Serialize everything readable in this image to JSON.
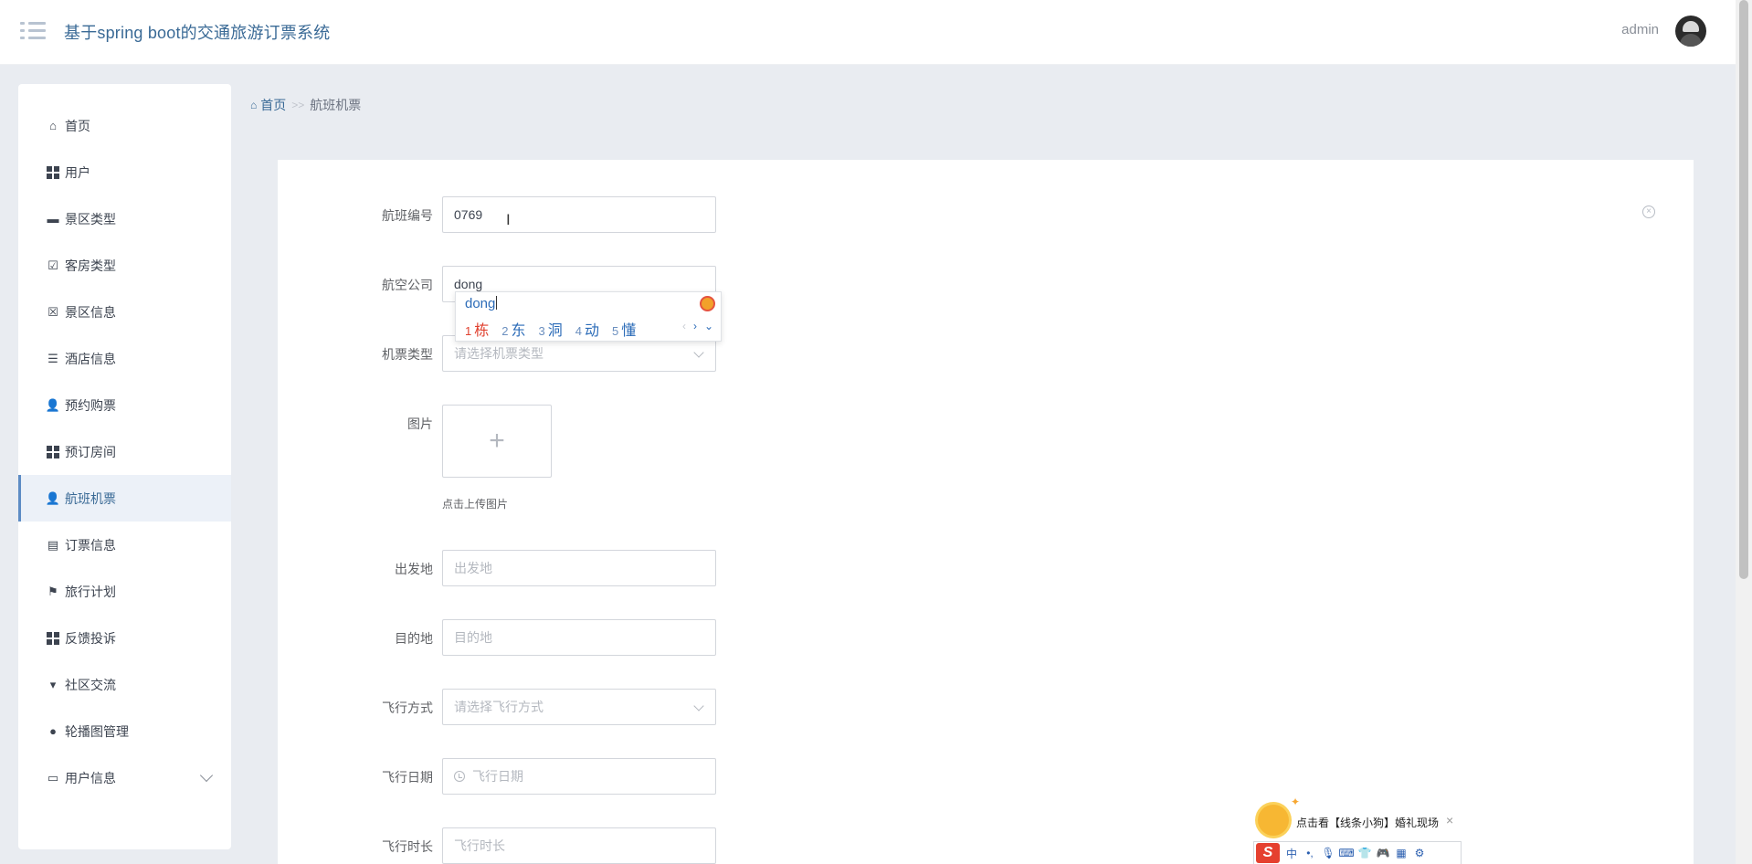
{
  "header": {
    "title": "基于spring boot的交通旅游订票系统",
    "user": "admin"
  },
  "sidebar": {
    "items": [
      {
        "label": "首页",
        "icon": "home-icon"
      },
      {
        "label": "用户",
        "icon": "grid-icon"
      },
      {
        "label": "景区类型",
        "icon": "comment-icon"
      },
      {
        "label": "客房类型",
        "icon": "clipboard-check-icon"
      },
      {
        "label": "景区信息",
        "icon": "clipboard-x-icon"
      },
      {
        "label": "酒店信息",
        "icon": "sliders-icon"
      },
      {
        "label": "预约购票",
        "icon": "person-icon"
      },
      {
        "label": "预订房间",
        "icon": "grid-icon"
      },
      {
        "label": "航班机票",
        "icon": "person-icon",
        "active": true
      },
      {
        "label": "订票信息",
        "icon": "clipboard-icon"
      },
      {
        "label": "旅行计划",
        "icon": "flag-icon"
      },
      {
        "label": "反馈投诉",
        "icon": "grid-icon"
      },
      {
        "label": "社区交流",
        "icon": "paint-roller-icon"
      },
      {
        "label": "轮播图管理",
        "icon": "leaf-icon"
      },
      {
        "label": "用户信息",
        "icon": "id-card-icon",
        "expandable": true
      }
    ]
  },
  "breadcrumb": {
    "home": "首页",
    "separator": ">>",
    "current": "航班机票"
  },
  "form": {
    "flight_no": {
      "label": "航班编号",
      "value": "0769"
    },
    "airline": {
      "label": "航空公司",
      "value": "dong"
    },
    "ticket_type": {
      "label": "机票类型",
      "placeholder": "请选择机票类型"
    },
    "image": {
      "label": "图片",
      "upload_plus": "+",
      "hint": "点击上传图片"
    },
    "departure": {
      "label": "出发地",
      "placeholder": "出发地"
    },
    "destination": {
      "label": "目的地",
      "placeholder": "目的地"
    },
    "flight_mode": {
      "label": "飞行方式",
      "placeholder": "请选择飞行方式"
    },
    "flight_date": {
      "label": "飞行日期",
      "placeholder": "飞行日期"
    },
    "flight_duration": {
      "label": "飞行时长",
      "placeholder": "飞行时长"
    }
  },
  "ime": {
    "composition": "dong",
    "candidates": [
      {
        "num": "1",
        "text": "栋"
      },
      {
        "num": "2",
        "text": "东"
      },
      {
        "num": "3",
        "text": "洞"
      },
      {
        "num": "4",
        "text": "动"
      },
      {
        "num": "5",
        "text": "懂"
      }
    ],
    "prev": "‹",
    "next": "›",
    "expand": "⌄"
  },
  "float_ad": {
    "text": "点击看【线条小狗】婚礼现场",
    "close": "×"
  },
  "ime_bar": {
    "logo": "S",
    "mode": "中",
    "punct": "•,",
    "icons": [
      "mic-icon",
      "keyboard-icon",
      "skin-icon",
      "game-icon",
      "apps-icon",
      "settings-icon"
    ]
  }
}
